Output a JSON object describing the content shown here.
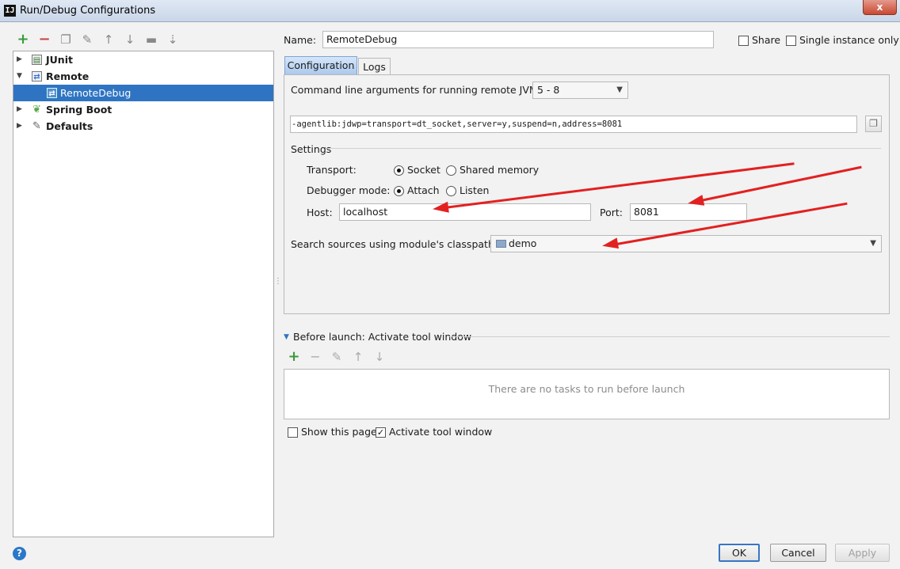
{
  "window": {
    "title": "Run/Debug Configurations",
    "logo": "IJ",
    "close_glyph": "x"
  },
  "toolbar": {
    "icons": [
      "add-icon",
      "remove-icon",
      "copy-icon",
      "wrench-icon",
      "move-up-icon",
      "move-down-icon",
      "folder-icon",
      "sort-icon"
    ]
  },
  "tree": {
    "items": [
      {
        "label": "JUnit",
        "expanded": false,
        "level": 0
      },
      {
        "label": "Remote",
        "expanded": true,
        "level": 0
      },
      {
        "label": "RemoteDebug",
        "level": 1,
        "selected": true
      },
      {
        "label": "Spring Boot",
        "expanded": false,
        "level": 0
      },
      {
        "label": "Defaults",
        "expanded": false,
        "level": 0
      }
    ]
  },
  "form": {
    "name_label": "Name:",
    "name_value": "RemoteDebug",
    "share_label": "Share",
    "single_instance_label": "Single instance only",
    "share_checked": false,
    "single_instance_checked": false
  },
  "tabs": {
    "configuration": "Configuration",
    "logs": "Logs"
  },
  "config": {
    "cmdline_label": "Command line arguments for running remote JVM",
    "jdk_select": "5 - 8",
    "cmdline_value": "-agentlib:jdwp=transport=dt_socket,server=y,suspend=n,address=8081",
    "settings_label": "Settings",
    "transport_label": "Transport:",
    "transport_options": [
      "Socket",
      "Shared memory"
    ],
    "transport_selected": "Socket",
    "debugger_mode_label": "Debugger mode:",
    "debugger_mode_options": [
      "Attach",
      "Listen"
    ],
    "debugger_mode_selected": "Attach",
    "host_label": "Host:",
    "host_value": "localhost",
    "port_label": "Port:",
    "port_value": "8081",
    "module_label": "Search sources using module's classpath:",
    "module_value": "demo"
  },
  "before_launch": {
    "title": "Before launch: Activate tool window",
    "empty_text": "There are no tasks to run before launch",
    "show_page_label": "Show this page",
    "show_page_checked": false,
    "activate_tool_label": "Activate tool window",
    "activate_tool_checked": true
  },
  "buttons": {
    "ok": "OK",
    "cancel": "Cancel",
    "apply": "Apply",
    "help": "?"
  },
  "colors": {
    "selection": "#2f74c2",
    "annotation_arrow": "#e32020",
    "tab_active": "#a9c7ec"
  }
}
